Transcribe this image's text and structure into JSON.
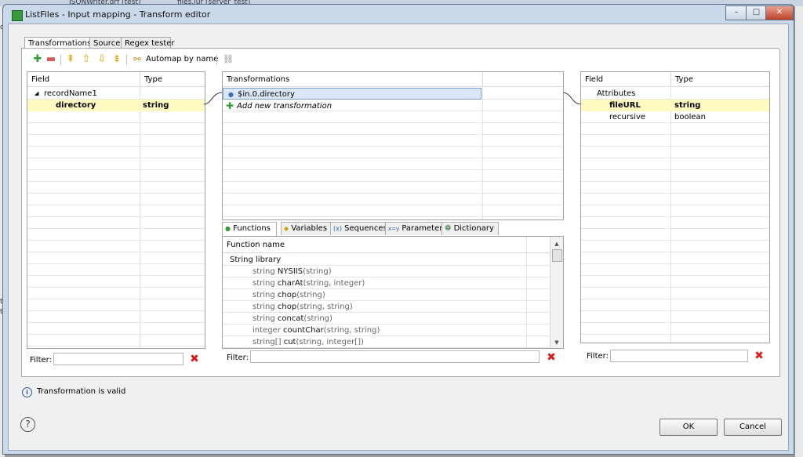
{
  "background": {
    "tab1": "JSONWriter.grf [test]",
    "tab2": "files.jur [server_test]",
    "left_fragments": [
      "os",
      "tl",
      "ta"
    ]
  },
  "window": {
    "title": "ListFiles - Input mapping - Transform editor",
    "controls": {
      "minimize": "–",
      "maximize": "□",
      "close": "✕"
    }
  },
  "tabs": [
    {
      "label": "Transformations",
      "active": true
    },
    {
      "label": "Source",
      "active": false
    },
    {
      "label": "Regex tester",
      "active": false
    }
  ],
  "toolbar": {
    "automap_label": "Automap by name",
    "icons": [
      "add-icon",
      "remove-icon",
      "move-top-icon",
      "move-up-icon",
      "move-down-icon",
      "move-bottom-icon",
      "automap-icon",
      "link-icon"
    ]
  },
  "input_table": {
    "headers": {
      "field": "Field",
      "type": "Type"
    },
    "rows": [
      {
        "field": "recordName1",
        "type": "",
        "expander": "◢"
      },
      {
        "field": "directory",
        "type": "string"
      }
    ],
    "filter_label": "Filter:",
    "filter_value": ""
  },
  "transformations": {
    "header": "Transformations",
    "items": [
      "$in.0.directory"
    ],
    "add_new": "Add new transformation"
  },
  "function_tabs": [
    {
      "label": "Functions",
      "icon": "●"
    },
    {
      "label": "Variables",
      "icon": "◆"
    },
    {
      "label": "Sequences",
      "icon": "(x)"
    },
    {
      "label": "Parameters",
      "icon": "x=y"
    },
    {
      "label": "Dictionary",
      "icon": "❁"
    }
  ],
  "function_list": {
    "header": "Function name",
    "group": "String library",
    "functions": [
      {
        "ret": "string",
        "name": "NYSIIS",
        "args": "(string)"
      },
      {
        "ret": "string",
        "name": "charAt",
        "args": "(string, integer)"
      },
      {
        "ret": "string",
        "name": "chop",
        "args": "(string)"
      },
      {
        "ret": "string",
        "name": "chop",
        "args": "(string, string)"
      },
      {
        "ret": "string",
        "name": "concat",
        "args": "(string)"
      },
      {
        "ret": "integer",
        "name": "countChar",
        "args": "(string, string)"
      },
      {
        "ret": "string[]",
        "name": "cut",
        "args": "(string, integer[])"
      }
    ],
    "filter_label": "Filter:",
    "filter_value": ""
  },
  "output_table": {
    "headers": {
      "field": "Field",
      "type": "Type"
    },
    "rows": [
      {
        "field": "Attributes",
        "type": ""
      },
      {
        "field": "fileURL",
        "type": "string"
      },
      {
        "field": "recursive",
        "type": "boolean"
      }
    ],
    "filter_label": "Filter:",
    "filter_value": ""
  },
  "status": {
    "icon": "info-icon",
    "text": "Transformation is valid"
  },
  "buttons": {
    "ok": "OK",
    "cancel": "Cancel",
    "help": "?"
  },
  "colors": {
    "selection": "#fffbc0",
    "delete": "#d42020",
    "add": "#2e9e2e"
  }
}
